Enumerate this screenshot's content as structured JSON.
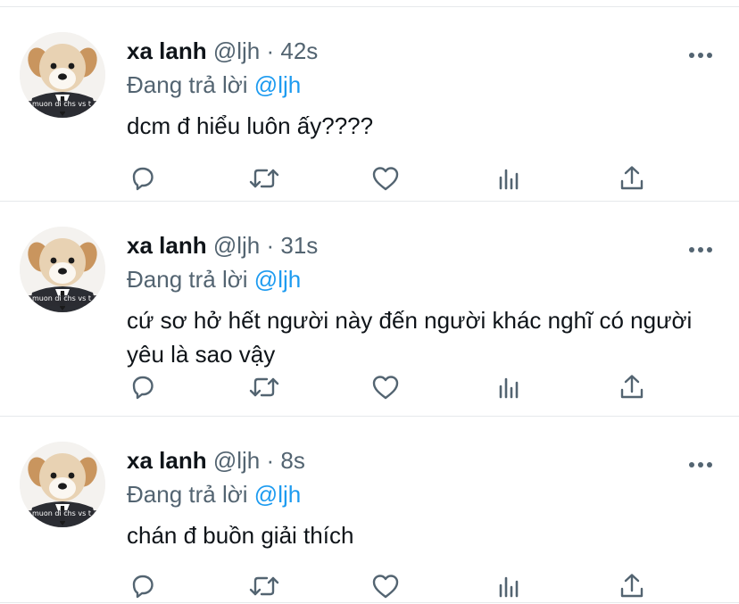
{
  "colors": {
    "text_primary": "#0f1419",
    "text_secondary": "#536471",
    "accent": "#1d9bf0",
    "divider": "#e6e9eb",
    "icon": "#536471"
  },
  "avatar_caption": "muon di chs vs t",
  "action_icons": [
    "reply-icon",
    "retweet-icon",
    "like-icon",
    "views-icon",
    "share-icon"
  ],
  "tweets": [
    {
      "name": "xa lanh",
      "handle": "@ljh",
      "separator": "·",
      "time": "42s",
      "replying_label": "Đang trả lời",
      "replying_to": "@ljh",
      "text": "dcm đ hiểu luôn ấy????"
    },
    {
      "name": "xa lanh",
      "handle": "@ljh",
      "separator": "·",
      "time": "31s",
      "replying_label": "Đang trả lời",
      "replying_to": "@ljh",
      "text": "cứ sơ hở hết người này đến người khác nghĩ có người yêu là sao vậy"
    },
    {
      "name": "xa lanh",
      "handle": "@ljh",
      "separator": "·",
      "time": "8s",
      "replying_label": "Đang trả lời",
      "replying_to": "@ljh",
      "text": "chán đ buồn giải thích"
    }
  ]
}
